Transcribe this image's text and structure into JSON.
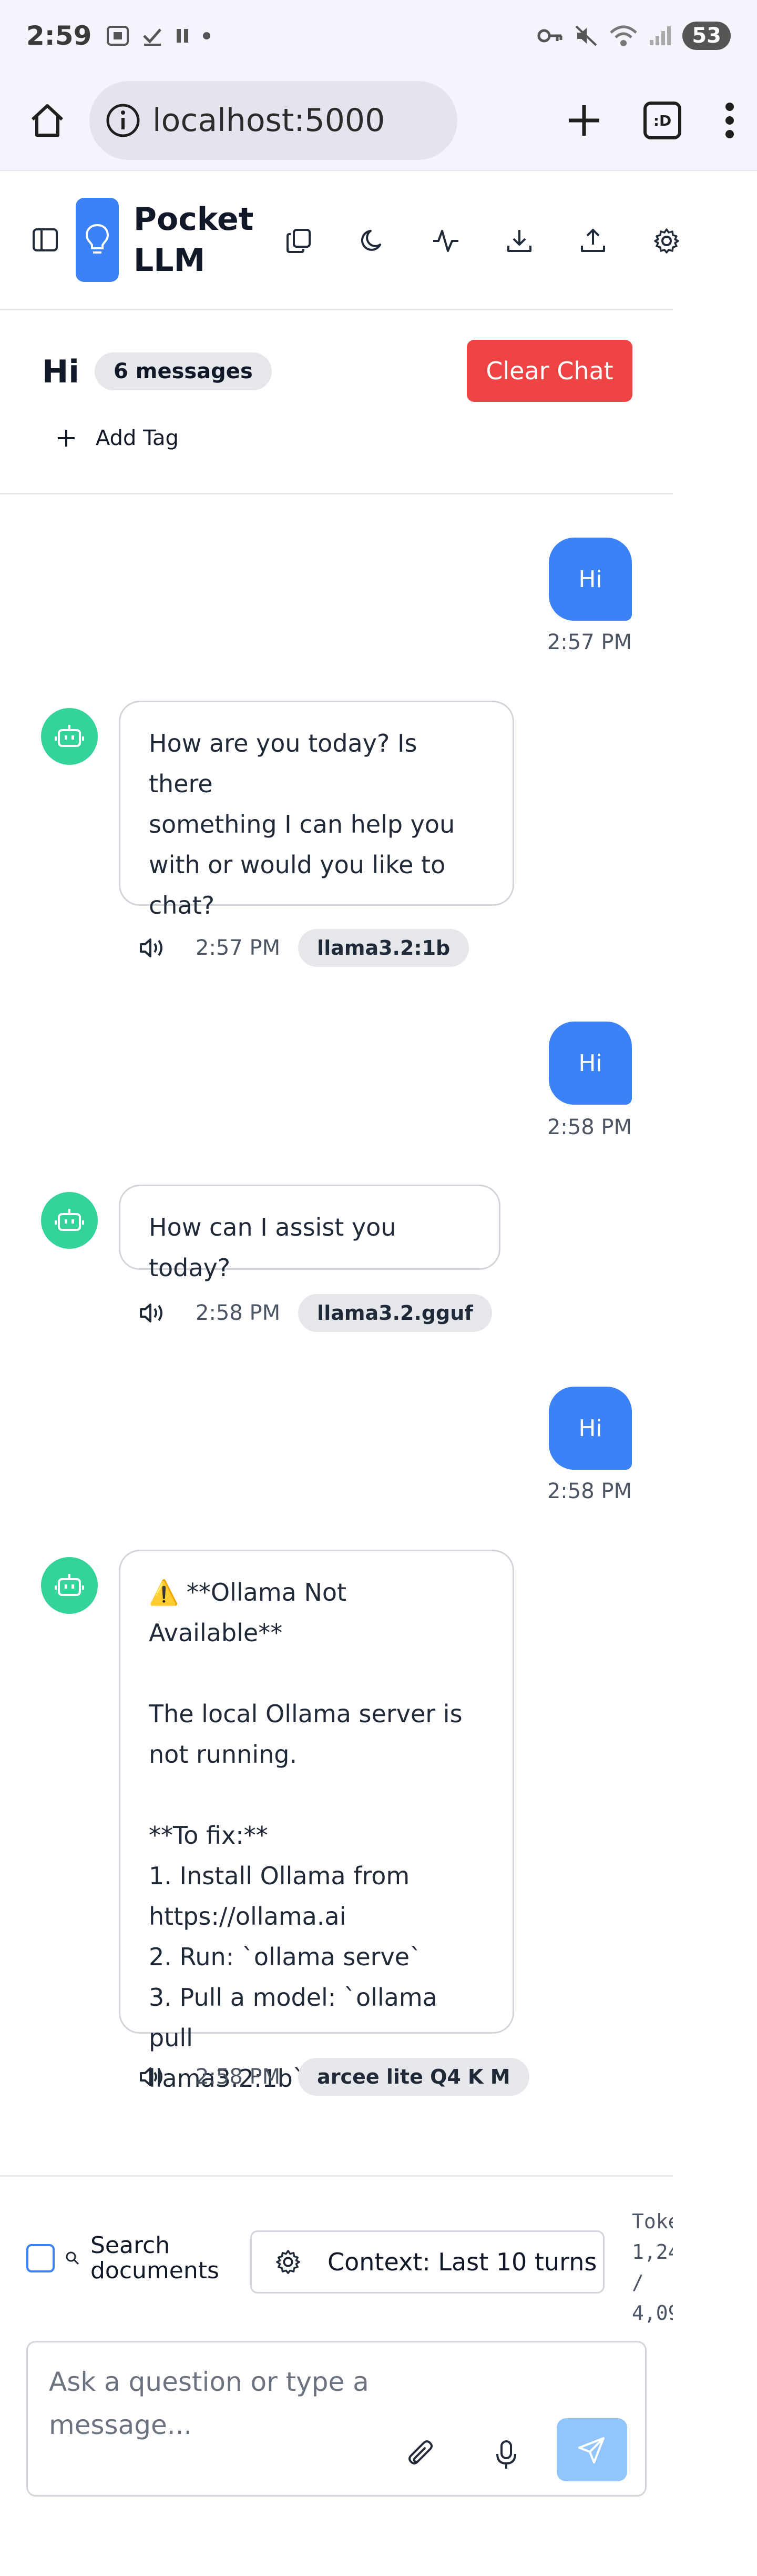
{
  "status_bar": {
    "time": "2:59",
    "battery": "53"
  },
  "browser": {
    "url": "localhost:5000",
    "tab_switcher_label": ":D"
  },
  "app": {
    "title": "Pocket LLM"
  },
  "chat": {
    "title": "Hi",
    "message_count": "6 messages",
    "clear_label": "Clear Chat",
    "add_tag_label": "Add Tag"
  },
  "messages": [
    {
      "role": "user",
      "text": "Hi",
      "time": "2:57 PM"
    },
    {
      "role": "assistant",
      "text": "How are you today? Is there\nsomething I can help you\nwith or would you like to\nchat?",
      "time": "2:57 PM",
      "model": "llama3.2:1b"
    },
    {
      "role": "user",
      "text": "Hi",
      "time": "2:58 PM"
    },
    {
      "role": "assistant",
      "text": "How can I assist you today?",
      "time": "2:58 PM",
      "model": "llama3.2.gguf"
    },
    {
      "role": "user",
      "text": "Hi",
      "time": "2:58 PM"
    },
    {
      "role": "assistant",
      "text": "⚠️ **Ollama Not Available**\n\nThe local Ollama server is\nnot running.\n\n**To fix:**\n1. Install Ollama from\nhttps://ollama.ai\n2. Run: `ollama serve`\n3. Pull a model: `ollama pull\nllama3.2:1b`",
      "time": "2:58 PM",
      "model": "arcee lite Q4 K M"
    }
  ],
  "bottom": {
    "search_docs_label": "Search\ndocuments",
    "context_label": "Context: Last 10 turns",
    "tokens_text": "Toke\n1,24\n/\n4,09",
    "input_placeholder": "Ask a question or type a message..."
  },
  "colors": {
    "primary": "#3b82f6",
    "danger": "#ef4444",
    "bot_avatar": "#34d399",
    "send_disabled": "#93c5fd"
  }
}
